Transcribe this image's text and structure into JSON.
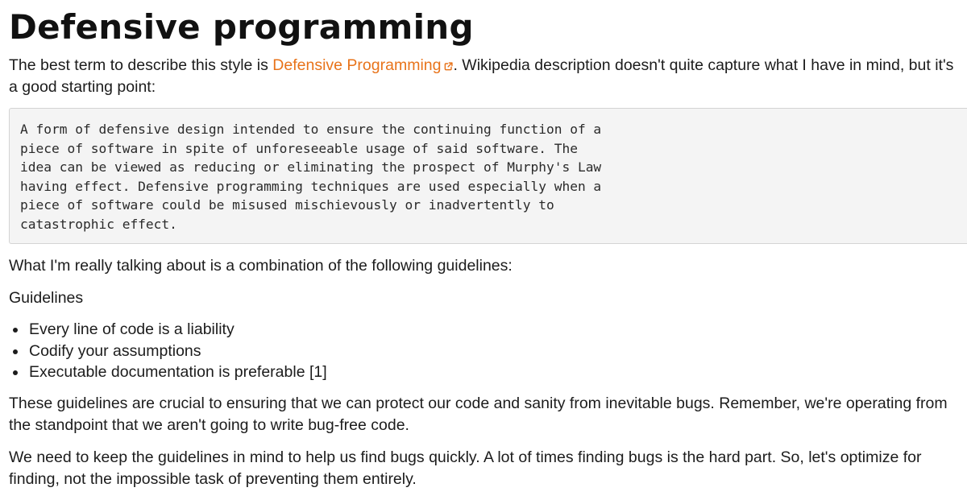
{
  "title": "Defensive programming",
  "intro": {
    "before": "The best term to describe this style is ",
    "link_text": "Defensive Programming",
    "after": ". Wikipedia description doesn't quite capture what I have in mind, but it's a good starting point:"
  },
  "quote": "A form of defensive design intended to ensure the continuing function of a\npiece of software in spite of unforeseeable usage of said software. The\nidea can be viewed as reducing or eliminating the prospect of Murphy's Law\nhaving effect. Defensive programming techniques are used especially when a\npiece of software could be misused mischievously or inadvertently to\ncatastrophic effect.",
  "talking_about": "What I'm really talking about is a combination of the following guidelines:",
  "guidelines_label": "Guidelines",
  "guidelines": [
    "Every line of code is a liability",
    "Codify your assumptions",
    "Executable documentation is preferable [1]"
  ],
  "paragraph_1": "These guidelines are crucial to ensuring that we can protect our code and sanity from inevitable bugs. Remember, we're operating from the standpoint that we aren't going to write bug-free code.",
  "paragraph_2": "We need to keep the guidelines in mind to help us find bugs quickly. A lot of times finding bugs is the hard part. So, let's optimize for finding, not the impossible task of preventing them entirely.",
  "colors": {
    "link": "#e8731a",
    "text": "#1c1c1c",
    "code_background": "#f4f4f4"
  },
  "icons": {
    "external_link": "external-link-icon"
  }
}
